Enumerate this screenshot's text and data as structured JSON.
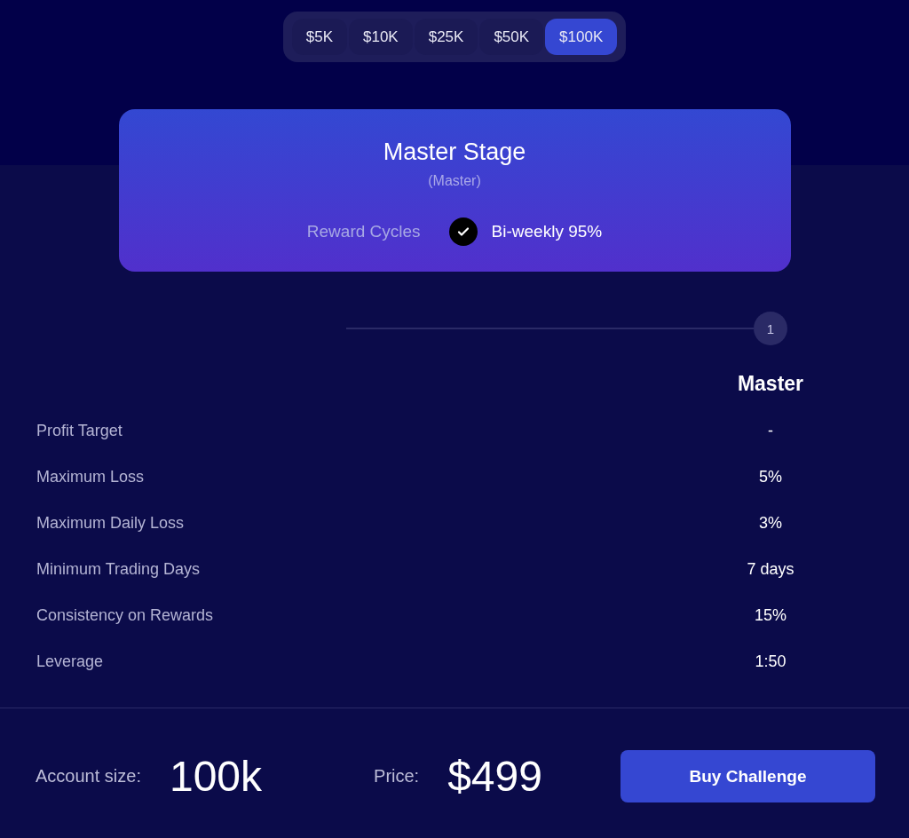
{
  "account_sizes": [
    {
      "label": "$5K",
      "selected": false
    },
    {
      "label": "$10K",
      "selected": false
    },
    {
      "label": "$25K",
      "selected": false
    },
    {
      "label": "$50K",
      "selected": false
    },
    {
      "label": "$100K",
      "selected": true
    }
  ],
  "stage_card": {
    "title": "Master Stage",
    "subtitle": "(Master)",
    "reward_label": "Reward Cycles",
    "reward_option": {
      "label": "Bi-weekly 95%",
      "checked": true
    }
  },
  "steps": [
    {
      "number": "1"
    }
  ],
  "rules": {
    "column": "Master",
    "rows": [
      {
        "label": "Profit Target",
        "value": "-"
      },
      {
        "label": "Maximum Loss",
        "value": "5%"
      },
      {
        "label": "Maximum Daily Loss",
        "value": "3%"
      },
      {
        "label": "Minimum Trading Days",
        "value": "7 days"
      },
      {
        "label": "Consistency on Rewards",
        "value": "15%"
      },
      {
        "label": "Leverage",
        "value": "1:50"
      }
    ]
  },
  "footer": {
    "account_label": "Account size:",
    "account_value": "100k",
    "price_label": "Price:",
    "price_value": "$499",
    "button": "Buy Challenge"
  }
}
